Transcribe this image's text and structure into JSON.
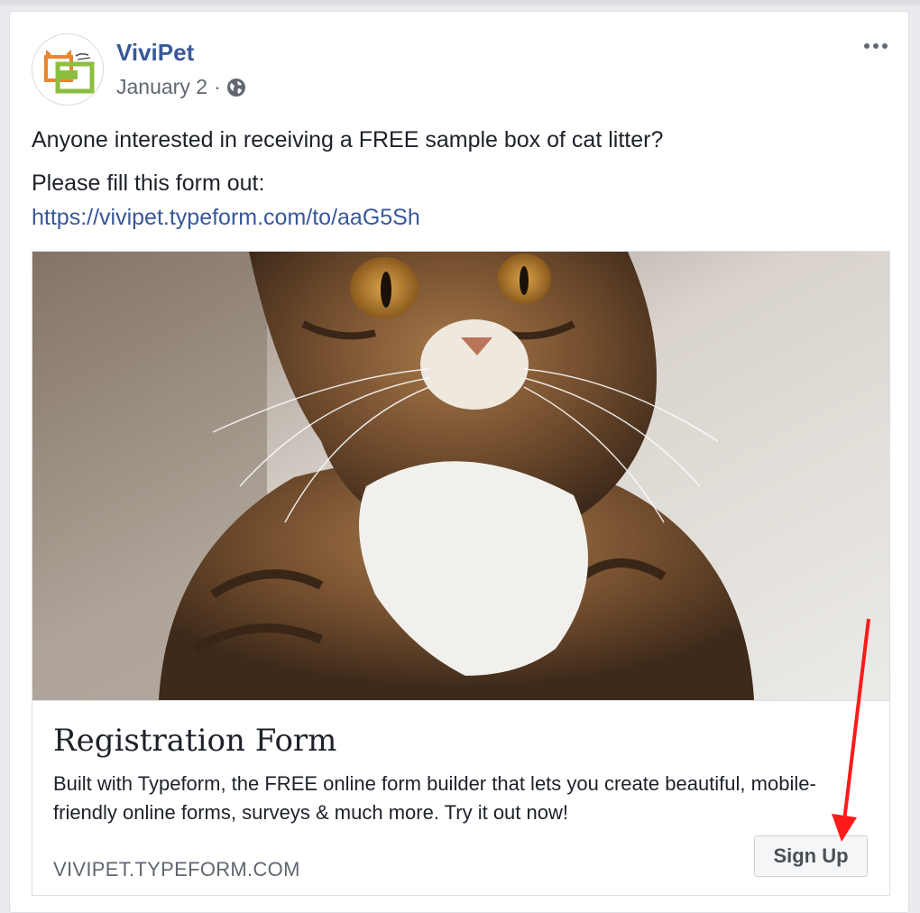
{
  "post": {
    "page_name": "ViviPet",
    "date": "January 2",
    "separator": "·",
    "privacy_icon": "globe-icon",
    "menu_icon": "more-horizontal-icon",
    "text_line_1": "Anyone interested in receiving a FREE sample box of cat litter?",
    "text_line_2": "Please fill this form out:",
    "link": "https://vivipet.typeform.com/to/aaG5Sh"
  },
  "card": {
    "image_subject": "tabby cat",
    "title": "Registration Form",
    "description": "Built with Typeform, the FREE online form builder that lets you create beautiful, mobile-friendly online forms, surveys & much more. Try it out now!",
    "domain": "VIVIPET.TYPEFORM.COM",
    "cta_label": "Sign Up"
  },
  "annotation": {
    "color": "#ff1a1a"
  },
  "colors": {
    "link": "#385898",
    "text": "#1d2129",
    "secondary": "#606770",
    "background": "#e9ebee"
  }
}
